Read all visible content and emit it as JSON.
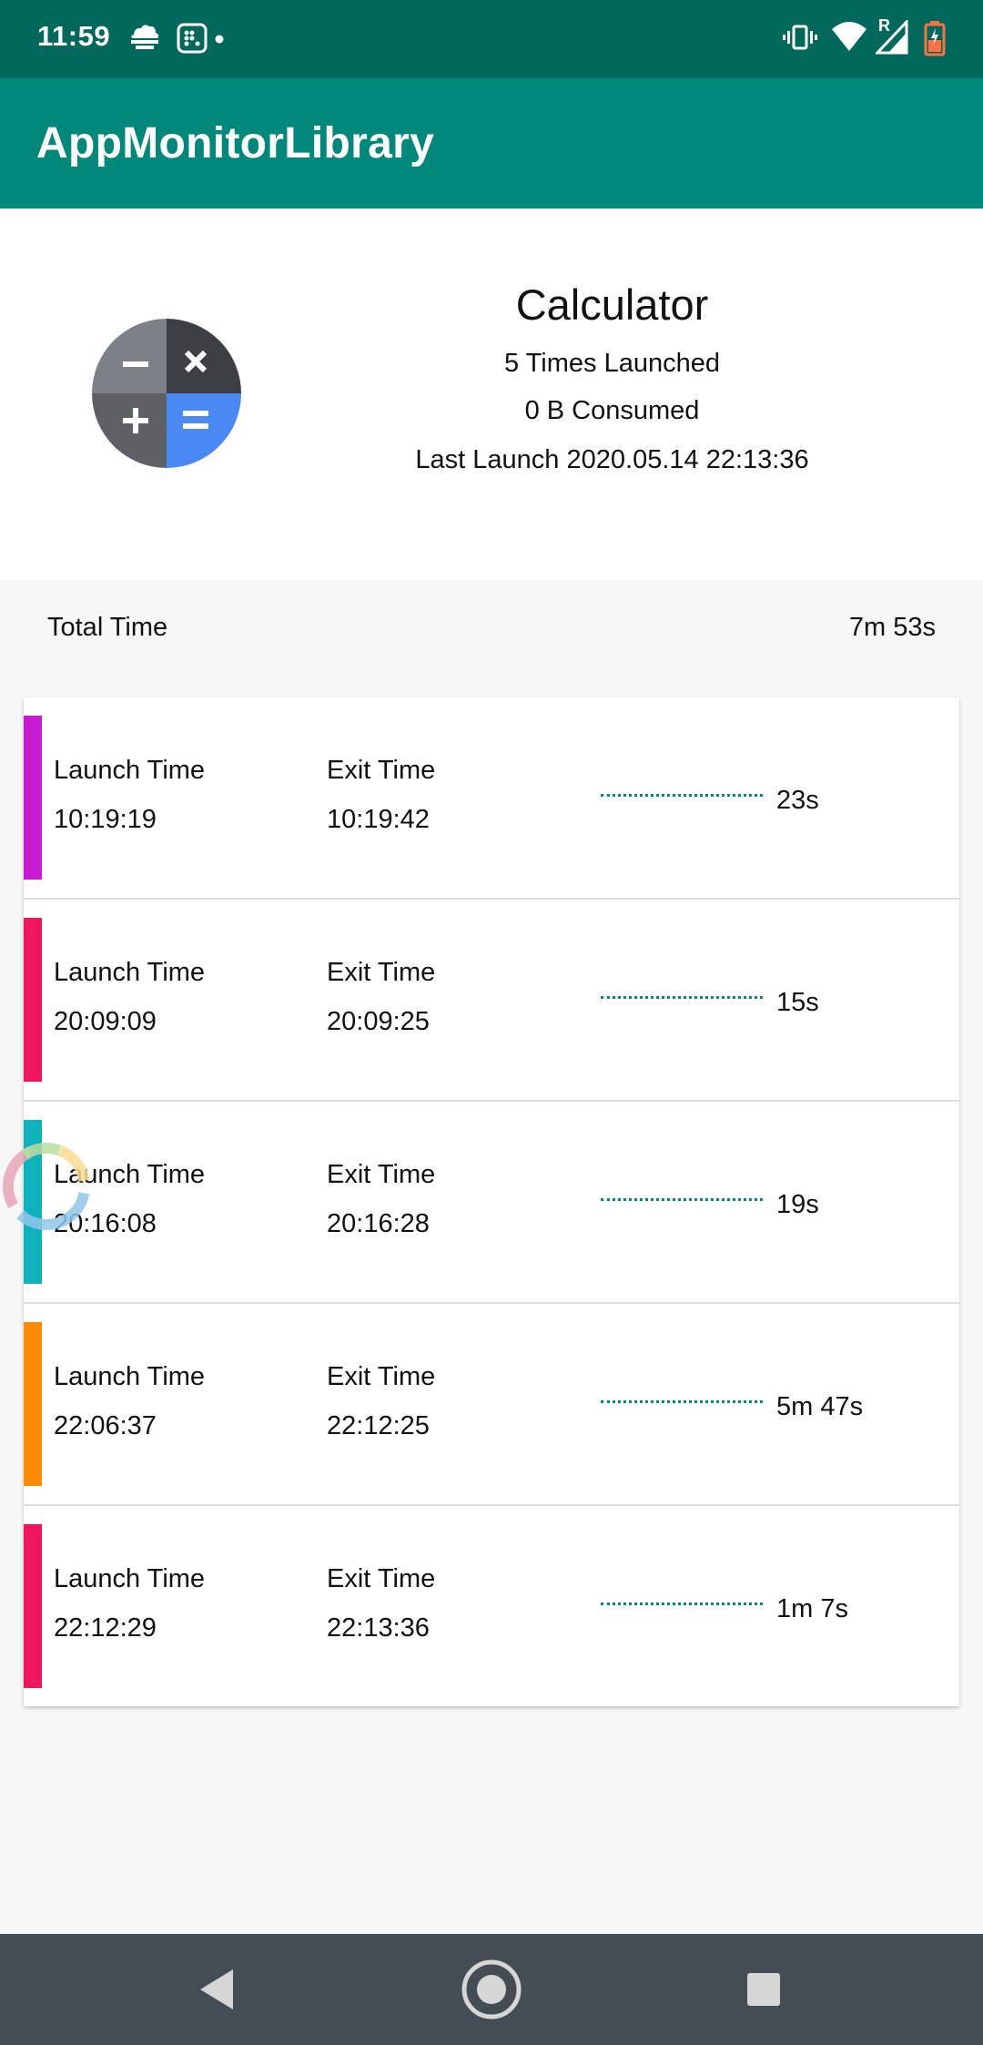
{
  "status_bar": {
    "time": "11:59",
    "notification_icons": [
      "cnbc-tv18-icon",
      "app-grid-icon",
      "dot-icon"
    ],
    "system_icons": [
      "vibrate-icon",
      "wifi-icon",
      "signal-icon",
      "battery-icon"
    ],
    "signal_label": "R"
  },
  "app_bar": {
    "title": "AppMonitorLibrary"
  },
  "app_info": {
    "name": "Calculator",
    "launched": "5 Times Launched",
    "consumed": "0 B Consumed",
    "last_launch": "Last Launch 2020.05.14 22:13:36",
    "icon": "calculator-icon"
  },
  "total": {
    "label": "Total Time",
    "value": "7m 53s"
  },
  "sessions": [
    {
      "launch_label": "Launch Time",
      "launch": "10:19:19",
      "exit_label": "Exit Time",
      "exit": "10:19:42",
      "duration": "23s",
      "color": "#c61bd0"
    },
    {
      "launch_label": "Launch Time",
      "launch": "20:09:09",
      "exit_label": "Exit Time",
      "exit": "20:09:25",
      "duration": "15s",
      "color": "#f0155f"
    },
    {
      "launch_label": "Launch Time",
      "launch": "20:16:08",
      "exit_label": "Exit Time",
      "exit": "20:16:28",
      "duration": "19s",
      "color": "#0fb1bd"
    },
    {
      "launch_label": "Launch Time",
      "launch": "22:06:37",
      "exit_label": "Exit Time",
      "exit": "22:12:25",
      "duration": "5m 47s",
      "color": "#fb8a06"
    },
    {
      "launch_label": "Launch Time",
      "launch": "22:12:29",
      "exit_label": "Exit Time",
      "exit": "22:13:36",
      "duration": "1m 7s",
      "color": "#f0155f"
    }
  ],
  "colors": {
    "status_bar": "#00695c",
    "app_bar": "#00897b",
    "nav_bar": "#454d54",
    "dash": "#00897b"
  },
  "nav": {
    "icons": [
      "back-icon",
      "home-icon",
      "recents-icon"
    ]
  }
}
